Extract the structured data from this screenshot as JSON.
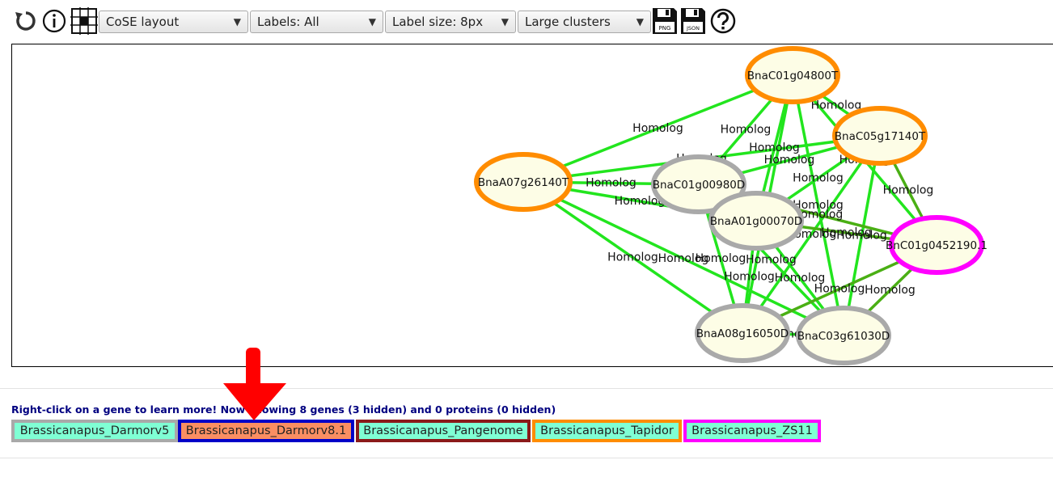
{
  "toolbar": {
    "reset_icon": "reset-icon",
    "info_icon": "info-icon",
    "grid_icon": "grid-icon",
    "layout": "CoSE layout",
    "labels": "Labels: All",
    "label_size": "Label size: 8px",
    "clusters": "Large clusters",
    "save_png_label": "PNG",
    "save_json_label": "JSON",
    "help_icon": "help-icon"
  },
  "graph": {
    "colors": {
      "edge": "#22e51e",
      "edge_dark": "#4aaf14",
      "node_fill": "#fdfde6",
      "gray": "#a9a9a9",
      "orange": "#ff8c00",
      "magenta": "#ff00ff"
    },
    "nodes": [
      {
        "id": "BnaC01g04800T",
        "label": "BnaC01g04800T",
        "border": "orange"
      },
      {
        "id": "BnaC05g17140T",
        "label": "BnaC05g17140T",
        "border": "orange"
      },
      {
        "id": "BnaA07g26140T",
        "label": "BnaA07g26140T",
        "border": "orange"
      },
      {
        "id": "BnaC01g00980D",
        "label": "BnaC01g00980D",
        "border": "gray"
      },
      {
        "id": "BnaA01g00070D",
        "label": "BnaA01g00070D",
        "border": "gray"
      },
      {
        "id": "BnC01g0452190.1",
        "label": "BnC01g0452190.1",
        "border": "magenta"
      },
      {
        "id": "BnaA08g16050D",
        "label": "BnaA08g16050D",
        "border": "gray"
      },
      {
        "id": "BnaC03g61030D",
        "label": "BnaC03g61030D",
        "border": "gray"
      }
    ],
    "edge_label": "Homolog"
  },
  "info": {
    "text": "Right-click on a gene to learn more! Now showing 8 genes (3 hidden) and 0 proteins (0 hidden)"
  },
  "legend": [
    {
      "label": "Brassicanapus_Darmorv5",
      "bg": "#7fffd4",
      "border": "#a9a9a9"
    },
    {
      "label": "Brassicanapus_Darmorv8.1",
      "bg": "#fa8e62",
      "border": "#0000c8"
    },
    {
      "label": "Brassicanapus_Pangenome",
      "bg": "#7fffd4",
      "border": "#8b1a1a"
    },
    {
      "label": "Brassicanapus_Tapidor",
      "bg": "#7fffd4",
      "border": "#ff8c00"
    },
    {
      "label": "Brassicanapus_ZS11",
      "bg": "#7fffd4",
      "border": "#ff00ff"
    }
  ],
  "annotation": {
    "arrow_color": "#ff0000"
  }
}
